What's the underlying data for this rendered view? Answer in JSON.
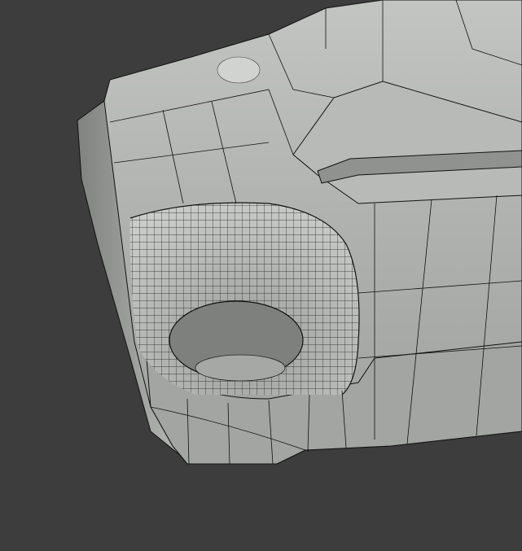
{
  "viewport": {
    "background_color": "#3d3d3d",
    "mesh_color": "#a9aca9",
    "mesh_light_color": "#c4c7c4",
    "wire_color": "#111111"
  }
}
